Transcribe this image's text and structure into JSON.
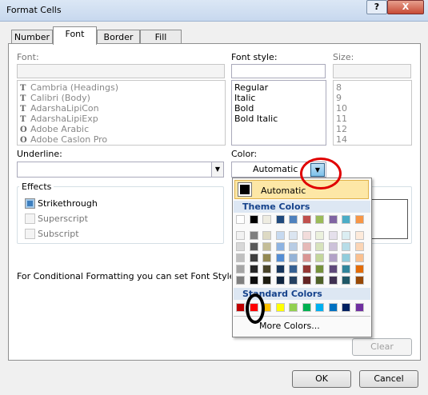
{
  "window": {
    "title": "Format Cells",
    "help_label": "?",
    "close_label": "X"
  },
  "tabs": [
    {
      "label": "Number"
    },
    {
      "label": "Font"
    },
    {
      "label": "Border"
    },
    {
      "label": "Fill"
    }
  ],
  "font": {
    "label": "Font:",
    "value": "",
    "items": [
      "Cambria (Headings)",
      "Calibri (Body)",
      "AdarshaLipiCon",
      "AdarshaLipiExp",
      "Adobe Arabic",
      "Adobe Caslon Pro"
    ]
  },
  "font_style": {
    "label": "Font style:",
    "value": "",
    "items": [
      "Regular",
      "Italic",
      "Bold",
      "Bold Italic"
    ]
  },
  "size": {
    "label": "Size:",
    "value": "",
    "items": [
      "8",
      "9",
      "10",
      "11",
      "12",
      "14"
    ]
  },
  "underline": {
    "label": "Underline:",
    "value": ""
  },
  "color": {
    "label": "Color:",
    "value": "Automatic"
  },
  "effects": {
    "legend": "Effects",
    "strikethrough": {
      "label": "Strikethrough",
      "checked": true
    },
    "superscript": {
      "label": "Superscript"
    },
    "subscript": {
      "label": "Subscript"
    }
  },
  "info_text": "For Conditional Formatting you can set Font Style, Unde",
  "color_popup": {
    "automatic_label": "Automatic",
    "theme_colors_label": "Theme Colors",
    "standard_colors_label": "Standard Colors",
    "more_colors_label": "More Colors...",
    "theme_top": [
      "#ffffff",
      "#000000",
      "#eeece1",
      "#1f497d",
      "#4f81bd",
      "#c0504d",
      "#9bbb59",
      "#8064a2",
      "#4bacc6",
      "#f79646"
    ],
    "theme_shades": [
      [
        "#f2f2f2",
        "#7f7f7f",
        "#ddd9c3",
        "#c6d9f0",
        "#dbe5f1",
        "#f2dcdb",
        "#ebf1dd",
        "#e5e0ec",
        "#dbeef3",
        "#fdeada"
      ],
      [
        "#d8d8d8",
        "#595959",
        "#c4bd97",
        "#8db3e2",
        "#b8cce4",
        "#e5b9b7",
        "#d7e3bc",
        "#ccc1d9",
        "#b7dde8",
        "#fbd5b5"
      ],
      [
        "#bfbfbf",
        "#3f3f3f",
        "#938953",
        "#548dd4",
        "#95b3d7",
        "#d99694",
        "#c3d69b",
        "#b2a2c7",
        "#92cddc",
        "#fac08f"
      ],
      [
        "#a5a5a5",
        "#262626",
        "#494429",
        "#17365d",
        "#366092",
        "#953734",
        "#76923c",
        "#5f497a",
        "#31859b",
        "#e36c09"
      ],
      [
        "#7f7f7f",
        "#0c0c0c",
        "#1d1b10",
        "#0f243e",
        "#244061",
        "#632423",
        "#4f6128",
        "#3f3151",
        "#205867",
        "#974806"
      ]
    ],
    "standard": [
      "#c00000",
      "#ff0000",
      "#ffc000",
      "#ffff00",
      "#92d050",
      "#00b050",
      "#00b0f0",
      "#0070c0",
      "#002060",
      "#7030a0"
    ]
  },
  "buttons": {
    "clear": "Clear",
    "ok": "OK",
    "cancel": "Cancel"
  }
}
